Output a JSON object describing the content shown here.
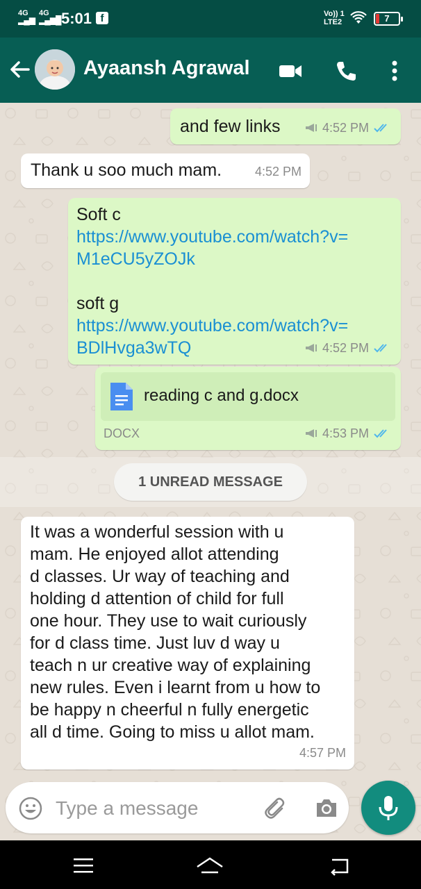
{
  "status_bar": {
    "network1": "4G",
    "network2": "4G",
    "time": "5:01",
    "lte_top": "Vo)) 1",
    "lte_bottom": "LTE2",
    "battery_level": "7",
    "battery_color": "#e53935"
  },
  "header": {
    "contact_name": "Ayaansh Agrawal",
    "icons": [
      "back-arrow-icon",
      "video-call-icon",
      "phone-icon",
      "more-vert-icon"
    ],
    "background": "#075e54"
  },
  "messages": [
    {
      "direction": "outgoing",
      "text": "and few links",
      "time": "4:52 PM",
      "status": "read"
    },
    {
      "direction": "incoming",
      "text": "Thank u soo much mam.",
      "time": "4:52 PM"
    },
    {
      "direction": "outgoing",
      "label1": "Soft c",
      "link1a": "https://www.youtube.com/watch?v=",
      "link1b": "M1eCU5yZOJk",
      "label2": "soft g",
      "link2a": "https://www.youtube.com/watch?v=",
      "link2b": "BDlHvga3wTQ",
      "time": "4:52 PM",
      "status": "read"
    },
    {
      "direction": "outgoing",
      "document_name": "reading c and g.docx",
      "document_type": "DOCX",
      "time": "4:53 PM",
      "status": "read"
    },
    {
      "direction": "incoming",
      "lines": [
        "It was a wonderful session with u",
        "mam. He enjoyed allot attending",
        "d classes. Ur way of teaching and",
        "holding d attention of child for full",
        "one hour. They use to wait curiously",
        "for d class time. Just luv d way u",
        "teach n ur creative way of explaining",
        "new rules. Even i learnt from u how to",
        "be happy n cheerful n fully energetic",
        "all d time. Going to miss u allot mam."
      ],
      "time": "4:57 PM"
    }
  ],
  "unread_divider": "1 UNREAD MESSAGE",
  "composer": {
    "placeholder": "Type a message",
    "icons": [
      "emoji-icon",
      "attach-icon",
      "camera-icon",
      "mic-icon"
    ],
    "accent": "#128c7e"
  },
  "colors": {
    "outgoing_bubble": "#dcf8c6",
    "incoming_bubble": "#ffffff",
    "link": "#1a8fd3",
    "read_ticks": "#4fb6ec"
  }
}
